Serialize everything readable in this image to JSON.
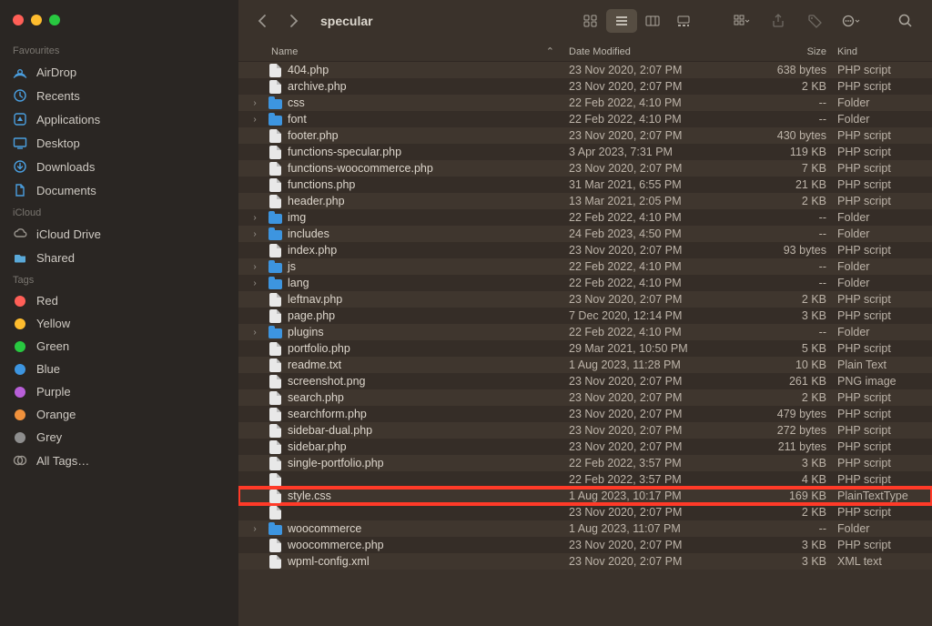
{
  "window": {
    "title": "specular"
  },
  "sidebar": {
    "sections": [
      {
        "label": "Favourites",
        "items": [
          {
            "label": "AirDrop",
            "icon": "airdrop"
          },
          {
            "label": "Recents",
            "icon": "clock"
          },
          {
            "label": "Applications",
            "icon": "app"
          },
          {
            "label": "Desktop",
            "icon": "desktop"
          },
          {
            "label": "Downloads",
            "icon": "download"
          },
          {
            "label": "Documents",
            "icon": "doc"
          }
        ]
      },
      {
        "label": "iCloud",
        "items": [
          {
            "label": "iCloud Drive",
            "icon": "cloud",
            "gray": true
          },
          {
            "label": "Shared",
            "icon": "shared"
          }
        ]
      },
      {
        "label": "Tags",
        "items": [
          {
            "label": "Red",
            "tag": "#ff5f57"
          },
          {
            "label": "Yellow",
            "tag": "#febc2e"
          },
          {
            "label": "Green",
            "tag": "#28c840"
          },
          {
            "label": "Blue",
            "tag": "#3d95e0"
          },
          {
            "label": "Purple",
            "tag": "#b85fd8"
          },
          {
            "label": "Orange",
            "tag": "#f0913c"
          },
          {
            "label": "Grey",
            "tag": "#8e8e8e"
          },
          {
            "label": "All Tags…",
            "icon": "alltags",
            "gray": true
          }
        ]
      }
    ]
  },
  "columns": {
    "name": "Name",
    "date": "Date Modified",
    "size": "Size",
    "kind": "Kind"
  },
  "files": [
    {
      "name": "404.php",
      "date": "23 Nov 2020, 2:07 PM",
      "size": "638 bytes",
      "kind": "PHP script",
      "type": "file"
    },
    {
      "name": "archive.php",
      "date": "23 Nov 2020, 2:07 PM",
      "size": "2 KB",
      "kind": "PHP script",
      "type": "file"
    },
    {
      "name": "css",
      "date": "22 Feb 2022, 4:10 PM",
      "size": "--",
      "kind": "Folder",
      "type": "folder"
    },
    {
      "name": "font",
      "date": "22 Feb 2022, 4:10 PM",
      "size": "--",
      "kind": "Folder",
      "type": "folder"
    },
    {
      "name": "footer.php",
      "date": "23 Nov 2020, 2:07 PM",
      "size": "430 bytes",
      "kind": "PHP script",
      "type": "file"
    },
    {
      "name": "functions-specular.php",
      "date": "3 Apr 2023, 7:31 PM",
      "size": "119 KB",
      "kind": "PHP script",
      "type": "file"
    },
    {
      "name": "functions-woocommerce.php",
      "date": "23 Nov 2020, 2:07 PM",
      "size": "7 KB",
      "kind": "PHP script",
      "type": "file"
    },
    {
      "name": "functions.php",
      "date": "31 Mar 2021, 6:55 PM",
      "size": "21 KB",
      "kind": "PHP script",
      "type": "file"
    },
    {
      "name": "header.php",
      "date": "13 Mar 2021, 2:05 PM",
      "size": "2 KB",
      "kind": "PHP script",
      "type": "file"
    },
    {
      "name": "img",
      "date": "22 Feb 2022, 4:10 PM",
      "size": "--",
      "kind": "Folder",
      "type": "folder"
    },
    {
      "name": "includes",
      "date": "24 Feb 2023, 4:50 PM",
      "size": "--",
      "kind": "Folder",
      "type": "folder"
    },
    {
      "name": "index.php",
      "date": "23 Nov 2020, 2:07 PM",
      "size": "93 bytes",
      "kind": "PHP script",
      "type": "file"
    },
    {
      "name": "js",
      "date": "22 Feb 2022, 4:10 PM",
      "size": "--",
      "kind": "Folder",
      "type": "folder"
    },
    {
      "name": "lang",
      "date": "22 Feb 2022, 4:10 PM",
      "size": "--",
      "kind": "Folder",
      "type": "folder"
    },
    {
      "name": "leftnav.php",
      "date": "23 Nov 2020, 2:07 PM",
      "size": "2 KB",
      "kind": "PHP script",
      "type": "file"
    },
    {
      "name": "page.php",
      "date": "7 Dec 2020, 12:14 PM",
      "size": "3 KB",
      "kind": "PHP script",
      "type": "file"
    },
    {
      "name": "plugins",
      "date": "22 Feb 2022, 4:10 PM",
      "size": "--",
      "kind": "Folder",
      "type": "folder"
    },
    {
      "name": "portfolio.php",
      "date": "29 Mar 2021, 10:50 PM",
      "size": "5 KB",
      "kind": "PHP script",
      "type": "file"
    },
    {
      "name": "readme.txt",
      "date": "1 Aug 2023, 11:28 PM",
      "size": "10 KB",
      "kind": "Plain Text",
      "type": "file"
    },
    {
      "name": "screenshot.png",
      "date": "23 Nov 2020, 2:07 PM",
      "size": "261 KB",
      "kind": "PNG image",
      "type": "file"
    },
    {
      "name": "search.php",
      "date": "23 Nov 2020, 2:07 PM",
      "size": "2 KB",
      "kind": "PHP script",
      "type": "file"
    },
    {
      "name": "searchform.php",
      "date": "23 Nov 2020, 2:07 PM",
      "size": "479 bytes",
      "kind": "PHP script",
      "type": "file"
    },
    {
      "name": "sidebar-dual.php",
      "date": "23 Nov 2020, 2:07 PM",
      "size": "272 bytes",
      "kind": "PHP script",
      "type": "file"
    },
    {
      "name": "sidebar.php",
      "date": "23 Nov 2020, 2:07 PM",
      "size": "211 bytes",
      "kind": "PHP script",
      "type": "file"
    },
    {
      "name": "single-portfolio.php",
      "date": "22 Feb 2022, 3:57 PM",
      "size": "3 KB",
      "kind": "PHP script",
      "type": "file"
    },
    {
      "name": "",
      "date": "22 Feb 2022, 3:57 PM",
      "size": "4 KB",
      "kind": "PHP script",
      "type": "file"
    },
    {
      "name": "style.css",
      "date": "1 Aug 2023, 10:17 PM",
      "size": "169 KB",
      "kind": "PlainTextType",
      "type": "file",
      "highlight": true
    },
    {
      "name": "",
      "date": "23 Nov 2020, 2:07 PM",
      "size": "2 KB",
      "kind": "PHP script",
      "type": "file"
    },
    {
      "name": "woocommerce",
      "date": "1 Aug 2023, 11:07 PM",
      "size": "--",
      "kind": "Folder",
      "type": "folder"
    },
    {
      "name": "woocommerce.php",
      "date": "23 Nov 2020, 2:07 PM",
      "size": "3 KB",
      "kind": "PHP script",
      "type": "file"
    },
    {
      "name": "wpml-config.xml",
      "date": "23 Nov 2020, 2:07 PM",
      "size": "3 KB",
      "kind": "XML text",
      "type": "file"
    }
  ]
}
